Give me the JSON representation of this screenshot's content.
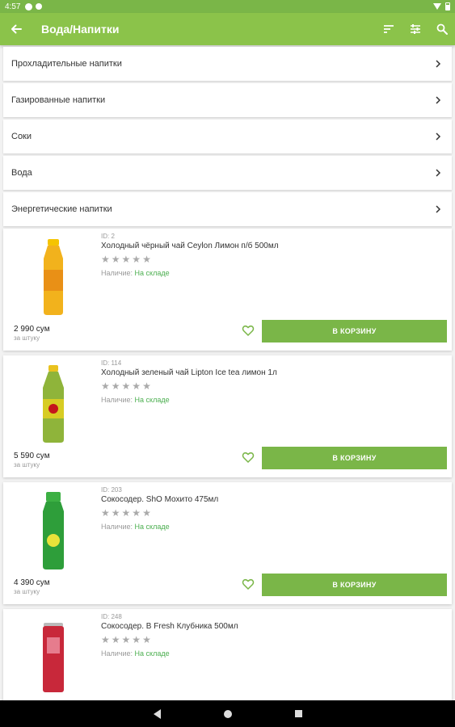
{
  "status_bar": {
    "time": "4:57"
  },
  "app_bar": {
    "title": "Вода/Напитки"
  },
  "categories": [
    {
      "label": "Прохладительные напитки"
    },
    {
      "label": "Газированные напитки"
    },
    {
      "label": "Соки"
    },
    {
      "label": "Вода"
    },
    {
      "label": "Энергетические напитки"
    }
  ],
  "products": [
    {
      "id": "ID: 2",
      "name": "Холодный чёрный чай Ceylon Лимон п/б 500мл",
      "stock_label": "Наличие:",
      "stock_value": "На складе",
      "price": "2 990 сум",
      "unit": "за штуку",
      "cart_label": "В КОРЗИНУ",
      "bottle_color": "#f2b21c",
      "cap_color": "#f5c400"
    },
    {
      "id": "ID: 114",
      "name": "Холодный зеленый чай Lipton Ice tea лимон 1л",
      "stock_label": "Наличие:",
      "stock_value": "На складе",
      "price": "5 590 сум",
      "unit": "за штуку",
      "cart_label": "В КОРЗИНУ",
      "bottle_color": "#8fb43a",
      "cap_color": "#e9c21e"
    },
    {
      "id": "ID: 203",
      "name": "Сокосодер. ShO Мохито 475мл",
      "stock_label": "Наличие:",
      "stock_value": "На складе",
      "price": "4 390 сум",
      "unit": "за штуку",
      "cart_label": "В КОРЗИНУ",
      "bottle_color": "#2e9e3a",
      "cap_color": "#3cb043"
    },
    {
      "id": "ID: 248",
      "name": "Сокосодер. B Fresh Клубника 500мл",
      "stock_label": "Наличие:",
      "stock_value": "На складе",
      "price": "",
      "unit": "",
      "cart_label": "",
      "bottle_color": "#c8283a",
      "cap_color": "#bbbbbb"
    }
  ],
  "colors": {
    "accent": "#8bc34a",
    "button": "#7ab648",
    "in_stock": "#4caf50"
  }
}
